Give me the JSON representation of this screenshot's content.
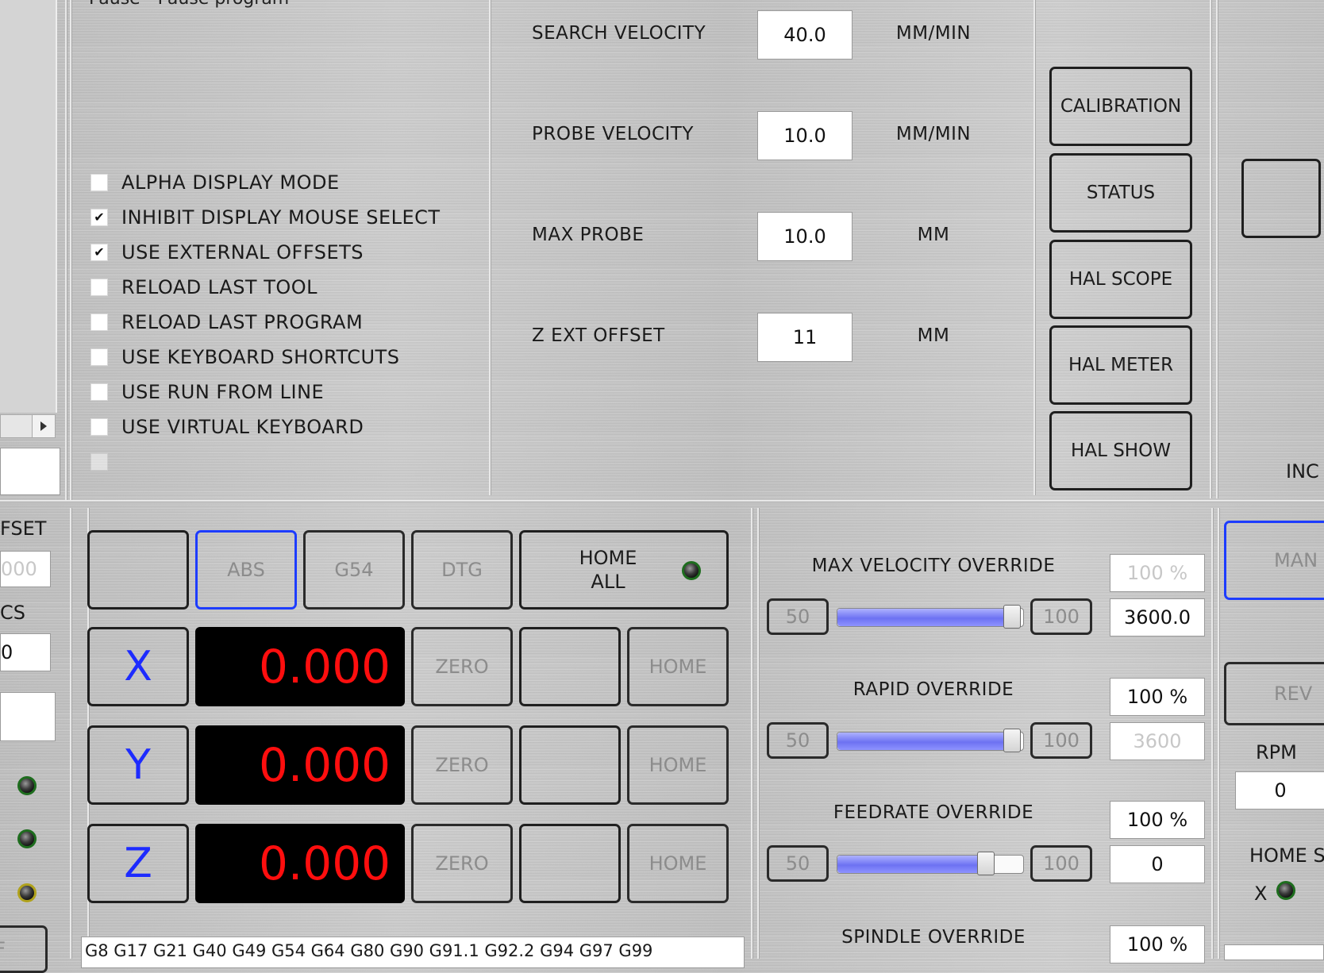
{
  "top_left_header": "Pause - Pause program",
  "options": [
    {
      "label": "ALPHA DISPLAY MODE",
      "checked": false
    },
    {
      "label": "INHIBIT DISPLAY MOUSE SELECT",
      "checked": true
    },
    {
      "label": "USE EXTERNAL OFFSETS",
      "checked": true
    },
    {
      "label": "RELOAD LAST TOOL",
      "checked": false
    },
    {
      "label": "RELOAD LAST PROGRAM",
      "checked": false
    },
    {
      "label": "USE KEYBOARD SHORTCUTS",
      "checked": false
    },
    {
      "label": "USE RUN FROM LINE",
      "checked": false
    },
    {
      "label": "USE VIRTUAL KEYBOARD",
      "checked": false
    },
    {
      "label": "",
      "checked": false
    }
  ],
  "probe": {
    "rows": [
      {
        "label": "SEARCH VELOCITY",
        "value": "40.0",
        "unit": "MM/MIN"
      },
      {
        "label": "PROBE VELOCITY",
        "value": "10.0",
        "unit": "MM/MIN"
      },
      {
        "label": "MAX PROBE",
        "value": "10.0",
        "unit": "MM"
      },
      {
        "label": "Z EXT OFFSET",
        "value": "11",
        "unit": "MM"
      }
    ]
  },
  "tools": {
    "calibration": "CALIBRATION",
    "status": "STATUS",
    "hal_scope": "HAL SCOPE",
    "hal_meter": "HAL METER",
    "hal_show": "HAL SHOW"
  },
  "right_top": {
    "inc": "INC"
  },
  "left_strip": {
    "offset_label": "FSET",
    "offset_value": "000",
    "cs_label": "CS",
    "cs_value": "0",
    "bottom_btn": "F"
  },
  "dro": {
    "modes": {
      "blank": "",
      "abs": "ABS",
      "g54": "G54",
      "dtg": "DTG"
    },
    "home_all": "HOME\nALL",
    "axes": [
      {
        "axis": "X",
        "value": "0.000",
        "zero": "ZERO",
        "home": "HOME"
      },
      {
        "axis": "Y",
        "value": "0.000",
        "zero": "ZERO",
        "home": "HOME"
      },
      {
        "axis": "Z",
        "value": "0.000",
        "zero": "ZERO",
        "home": "HOME"
      }
    ],
    "gcodes": "G8 G17 G21 G40 G49 G54 G64 G80 G90 G91.1 G92.2 G94 G97 G99"
  },
  "overrides": [
    {
      "title": "MAX VELOCITY OVERRIDE",
      "percent": "100 %",
      "percent_dim": true,
      "min": "50",
      "max": "100",
      "value": "3600.0",
      "value_dim": false,
      "level": 0.94
    },
    {
      "title": "RAPID OVERRIDE",
      "percent": "100 %",
      "percent_dim": false,
      "min": "50",
      "max": "100",
      "value": "3600",
      "value_dim": true,
      "level": 0.94
    },
    {
      "title": "FEEDRATE OVERRIDE",
      "percent": "100 %",
      "percent_dim": false,
      "min": "50",
      "max": "100",
      "value": "0",
      "value_dim": false,
      "level": 0.8
    },
    {
      "title": "SPINDLE OVERRIDE",
      "percent": "100 %",
      "percent_dim": false
    }
  ],
  "spindle": {
    "man": "MAN",
    "rev": "REV",
    "rpm_label": "RPM",
    "rpm_value": "0",
    "home_label": "HOME S",
    "x_label": "X"
  },
  "colors": {
    "accent_blue": "#1d3cff",
    "dro_text": "#ff0e0e",
    "axis_text": "#1d2bff",
    "slider_fill": "#6d72f2"
  }
}
